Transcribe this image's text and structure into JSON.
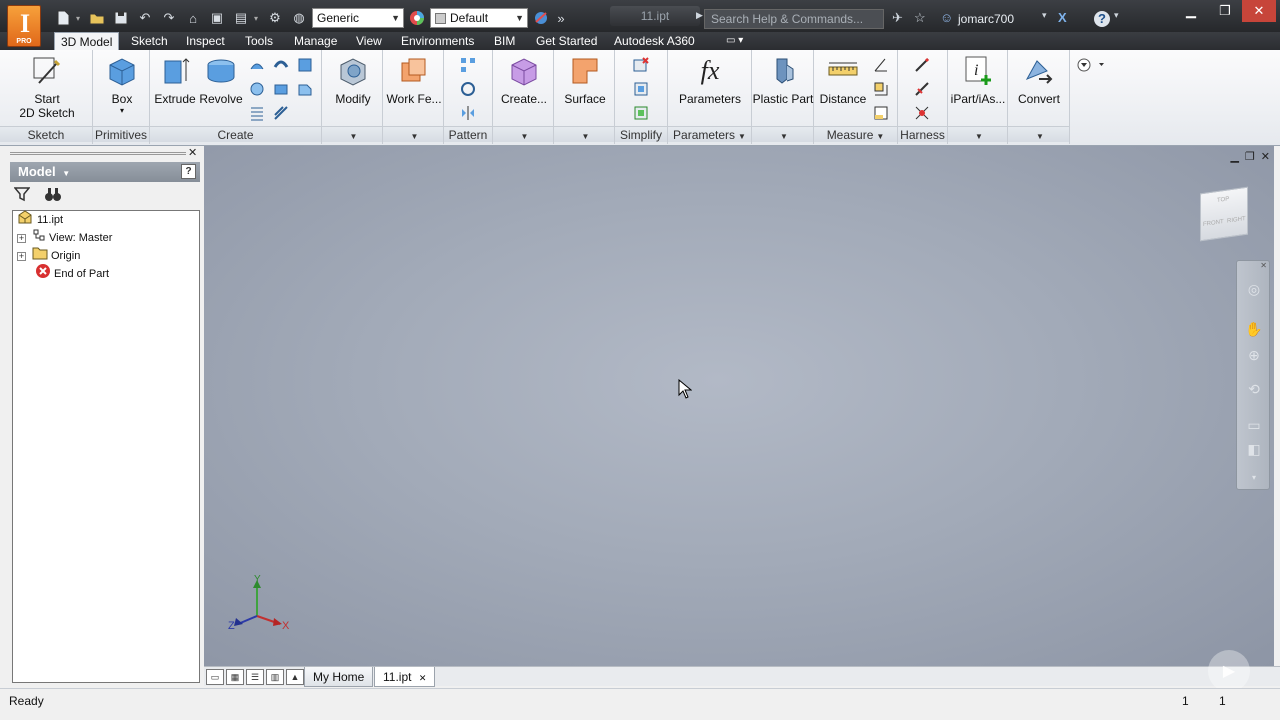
{
  "app": {
    "logo_text": "I",
    "edition": "PRO"
  },
  "title_bar": {
    "material_combo": "Generic",
    "appearance_combo": "Default",
    "document_title": "11.ipt",
    "search_placeholder": "Search Help & Commands...",
    "user": "jomarc700",
    "help": "?"
  },
  "ribbon_tabs": [
    "3D Model",
    "Sketch",
    "Inspect",
    "Tools",
    "Manage",
    "View",
    "Environments",
    "BIM",
    "Get Started",
    "Autodesk A360"
  ],
  "ribbon": {
    "sketch": {
      "label": "Sketch",
      "start_sketch": "Start",
      "start_sketch_2": "2D Sketch"
    },
    "primitives": {
      "label": "Primitives",
      "box": "Box"
    },
    "create": {
      "label": "Create",
      "extrude": "Extrude",
      "revolve": "Revolve"
    },
    "modify": {
      "label": "Modify"
    },
    "work_features": {
      "label": "Work Fe..."
    },
    "pattern": {
      "label": "Pattern"
    },
    "create_freeform": {
      "label": "Create..."
    },
    "surface": {
      "label": "Surface"
    },
    "simplify": {
      "label": "Simplify"
    },
    "parameters": {
      "label": "Parameters",
      "button": "Parameters",
      "symbol": "fx"
    },
    "plastic_part": {
      "label": "Plastic Part"
    },
    "measure": {
      "label": "Measure",
      "distance": "Distance"
    },
    "harness": {
      "label": "Harness"
    },
    "ipart": {
      "label": "iPart/iAs..."
    },
    "convert": {
      "label": "Convert"
    }
  },
  "browser": {
    "title": "Model",
    "help": "?",
    "tree": [
      {
        "label": "11.ipt"
      },
      {
        "label": "View: Master"
      },
      {
        "label": "Origin"
      },
      {
        "label": "End of Part"
      }
    ]
  },
  "viewport": {
    "triad": {
      "x": "X",
      "y": "Y",
      "z": "Z"
    },
    "viewcube": {
      "top": "TOP",
      "front": "FRONT",
      "right": "RIGHT"
    }
  },
  "doc_tabs": [
    "My Home",
    "11.ipt"
  ],
  "status": {
    "text": "Ready",
    "count1": "1",
    "count2": "1"
  }
}
